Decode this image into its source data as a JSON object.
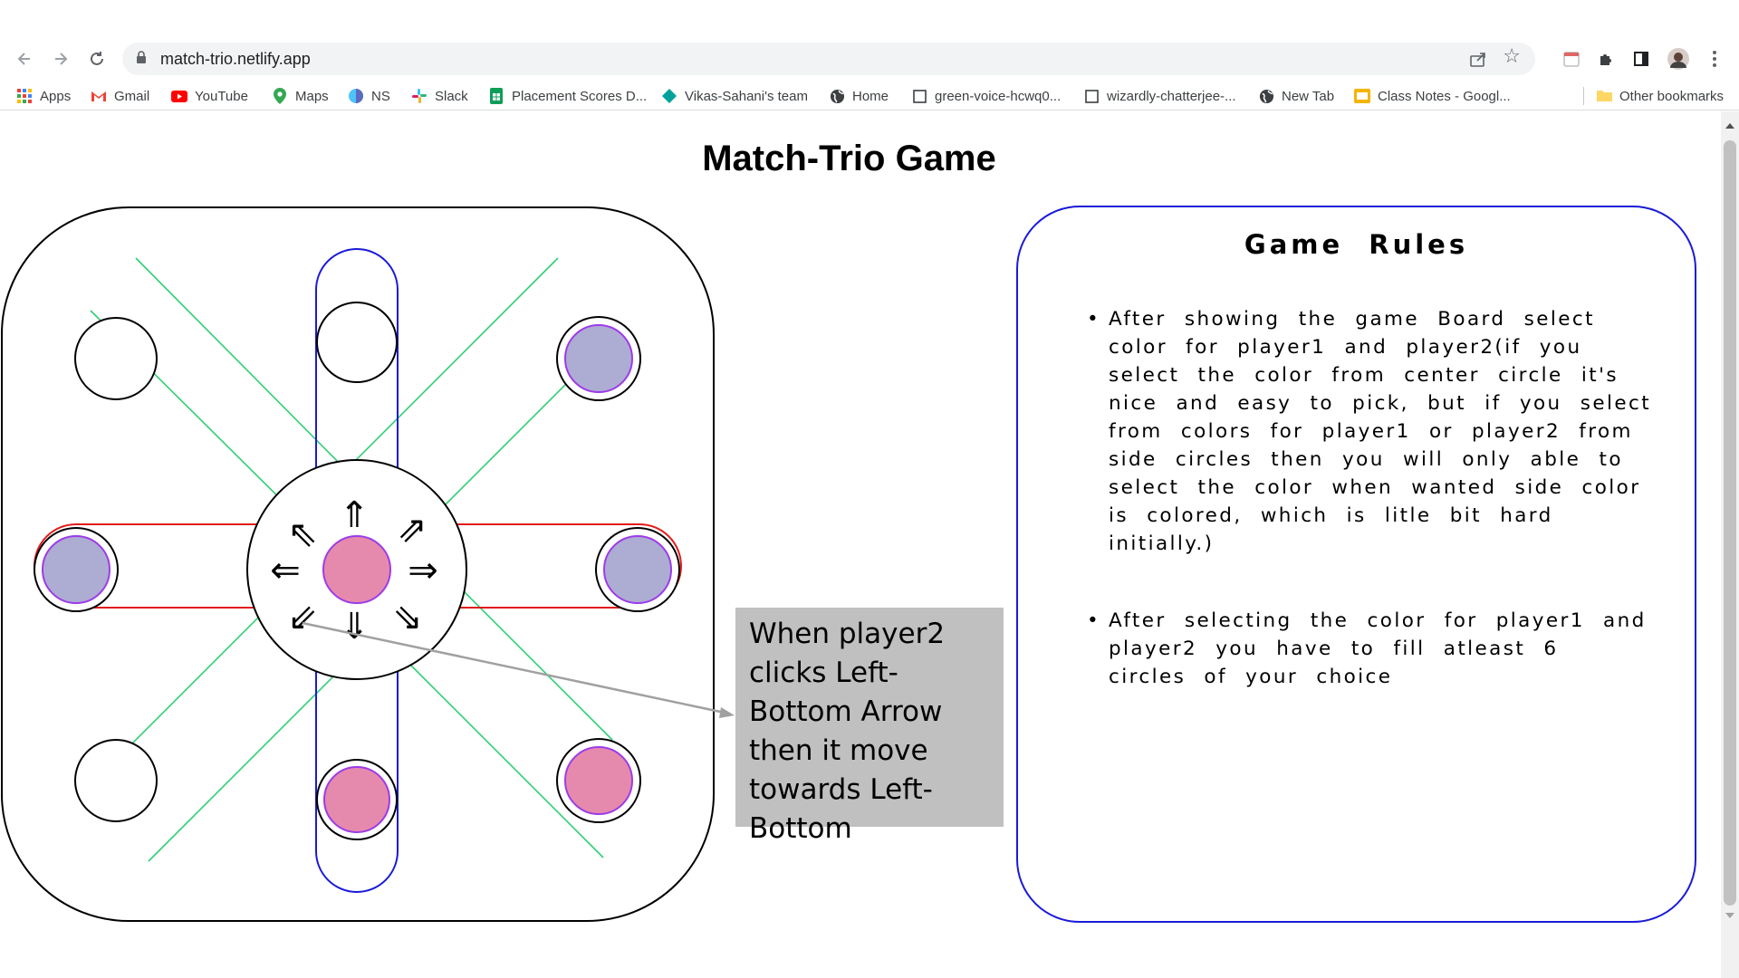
{
  "browser": {
    "url": "match-trio.netlify.app",
    "nav": {
      "back": "back-arrow",
      "forward": "forward-arrow",
      "reload": "reload-arrow"
    },
    "bookmarks": [
      {
        "label": "Apps",
        "icon": "apps-grid-icon"
      },
      {
        "label": "Gmail",
        "icon": "gmail-icon"
      },
      {
        "label": "YouTube",
        "icon": "youtube-icon"
      },
      {
        "label": "Maps",
        "icon": "maps-icon"
      },
      {
        "label": "NS",
        "icon": "ns-icon"
      },
      {
        "label": "Slack",
        "icon": "slack-icon"
      },
      {
        "label": "Placement Scores D...",
        "icon": "sheets-icon"
      },
      {
        "label": "Vikas-Sahani's team",
        "icon": "diamond-icon"
      },
      {
        "label": "Home",
        "icon": "globe-icon"
      },
      {
        "label": "green-voice-hcwq0...",
        "icon": "page-icon"
      },
      {
        "label": "wizardly-chatterjee-...",
        "icon": "page-icon"
      },
      {
        "label": "New Tab",
        "icon": "globe-icon"
      },
      {
        "label": "Class Notes - Googl...",
        "icon": "slides-icon"
      }
    ],
    "other_bookmarks": "Other bookmarks"
  },
  "page": {
    "title": "Match-Trio Game",
    "board": {
      "center_symbol_up": "⇑",
      "center_symbol_up_left": "⇖",
      "center_symbol_up_right": "⇗",
      "center_symbol_left": "⇐",
      "center_symbol_right": "⇒",
      "center_symbol_down_left": "⇙",
      "center_symbol_down": "⇓",
      "center_symbol_down_right": "⇘",
      "colors": {
        "player1": "#adacd3",
        "player2": "#e68aad",
        "chip_border": "#9d3be8",
        "lane_diagonal": "#2fcf74",
        "lane_vertical": "#1a1ad8",
        "lane_horizontal": "#e01b1b"
      }
    },
    "callout": "When player2 clicks Left-Bottom Arrow then it move towards Left-Bottom",
    "rules": {
      "heading": "Game Rules",
      "items": [
        "After showing the game Board select color for player1 and player2(if you select the color from center circle it's nice and easy to pick, but if you select from colors for player1 or player2 from side circles then you will only able to select the color when wanted side color is colored, which is litle bit hard initially.)",
        "After selecting the color for player1 and player2 you have to fill atleast 6 circles of your choice"
      ]
    }
  }
}
